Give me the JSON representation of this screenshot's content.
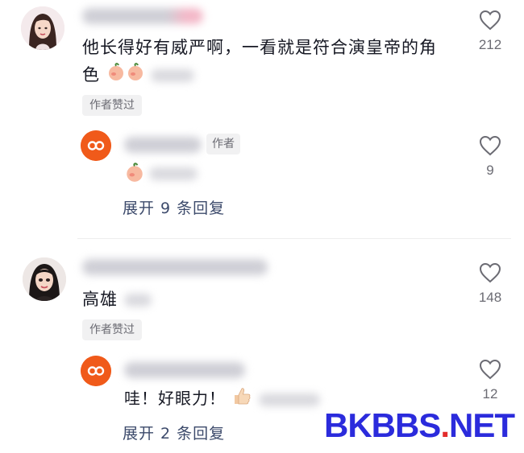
{
  "comments": [
    {
      "text_line1": "他长得好有威严啊，一看就是符合演皇帝的角",
      "text_line2": "色",
      "tag": "作者赞过",
      "like_count": "212",
      "reply": {
        "author_tag": "作者",
        "like_count": "9"
      },
      "expand_label": "展开 9 条回复"
    },
    {
      "text": "高雄",
      "tag": "作者赞过",
      "like_count": "148",
      "reply": {
        "text": "哇！好眼力！",
        "like_count": "12"
      },
      "expand_label": "展开 2 条回复"
    }
  ],
  "watermark": {
    "part1": "BKBBS",
    "part2": ".",
    "part3": "NET"
  },
  "icons": {
    "like": "heart-outline-icon",
    "emoji_peach": "peach-emoji-icon",
    "emoji_thumb": "thumbs-up-emoji-icon"
  },
  "colors": {
    "text": "#161823",
    "muted": "#6b6b73",
    "expand": "#3c4a6b",
    "reply_avatar": "#f05a1a",
    "watermark_blue": "#2b2bdc",
    "watermark_red": "#e22b2b"
  }
}
